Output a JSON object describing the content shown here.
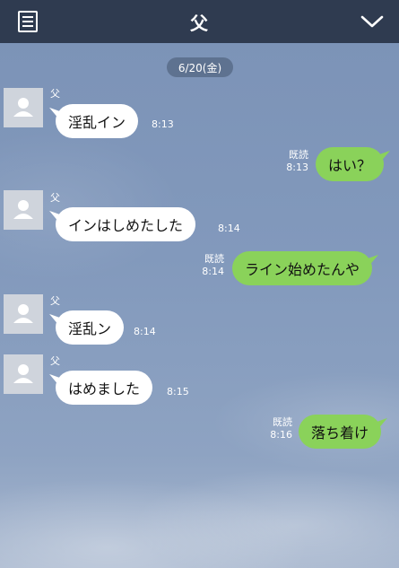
{
  "header": {
    "title": "父"
  },
  "date_label": "6/20(金)",
  "messages": [
    {
      "side": "in",
      "sender": "父",
      "text": "淫乱イン",
      "time": "8:13"
    },
    {
      "side": "out",
      "read": "既読",
      "text": "はい？",
      "time": "8:13"
    },
    {
      "side": "in",
      "sender": "父",
      "text": "インはしめたした",
      "time": "8:14"
    },
    {
      "side": "out",
      "read": "既読",
      "text": "ライン始めたんや",
      "time": "8:14"
    },
    {
      "side": "in",
      "sender": "父",
      "text": "淫乱ン",
      "time": "8:14"
    },
    {
      "side": "in",
      "sender": "父",
      "text": "はめました",
      "time": "8:15"
    },
    {
      "side": "out",
      "read": "既読",
      "text": "落ち着け",
      "time": "8:16"
    }
  ],
  "icons": {
    "menu": "list-icon",
    "collapse": "chevron-down-icon",
    "avatar": "person-silhouette-icon"
  },
  "colors": {
    "header_bg": "#2f3b50",
    "incoming_bubble": "#ffffff",
    "outgoing_bubble": "#8ad25a"
  }
}
